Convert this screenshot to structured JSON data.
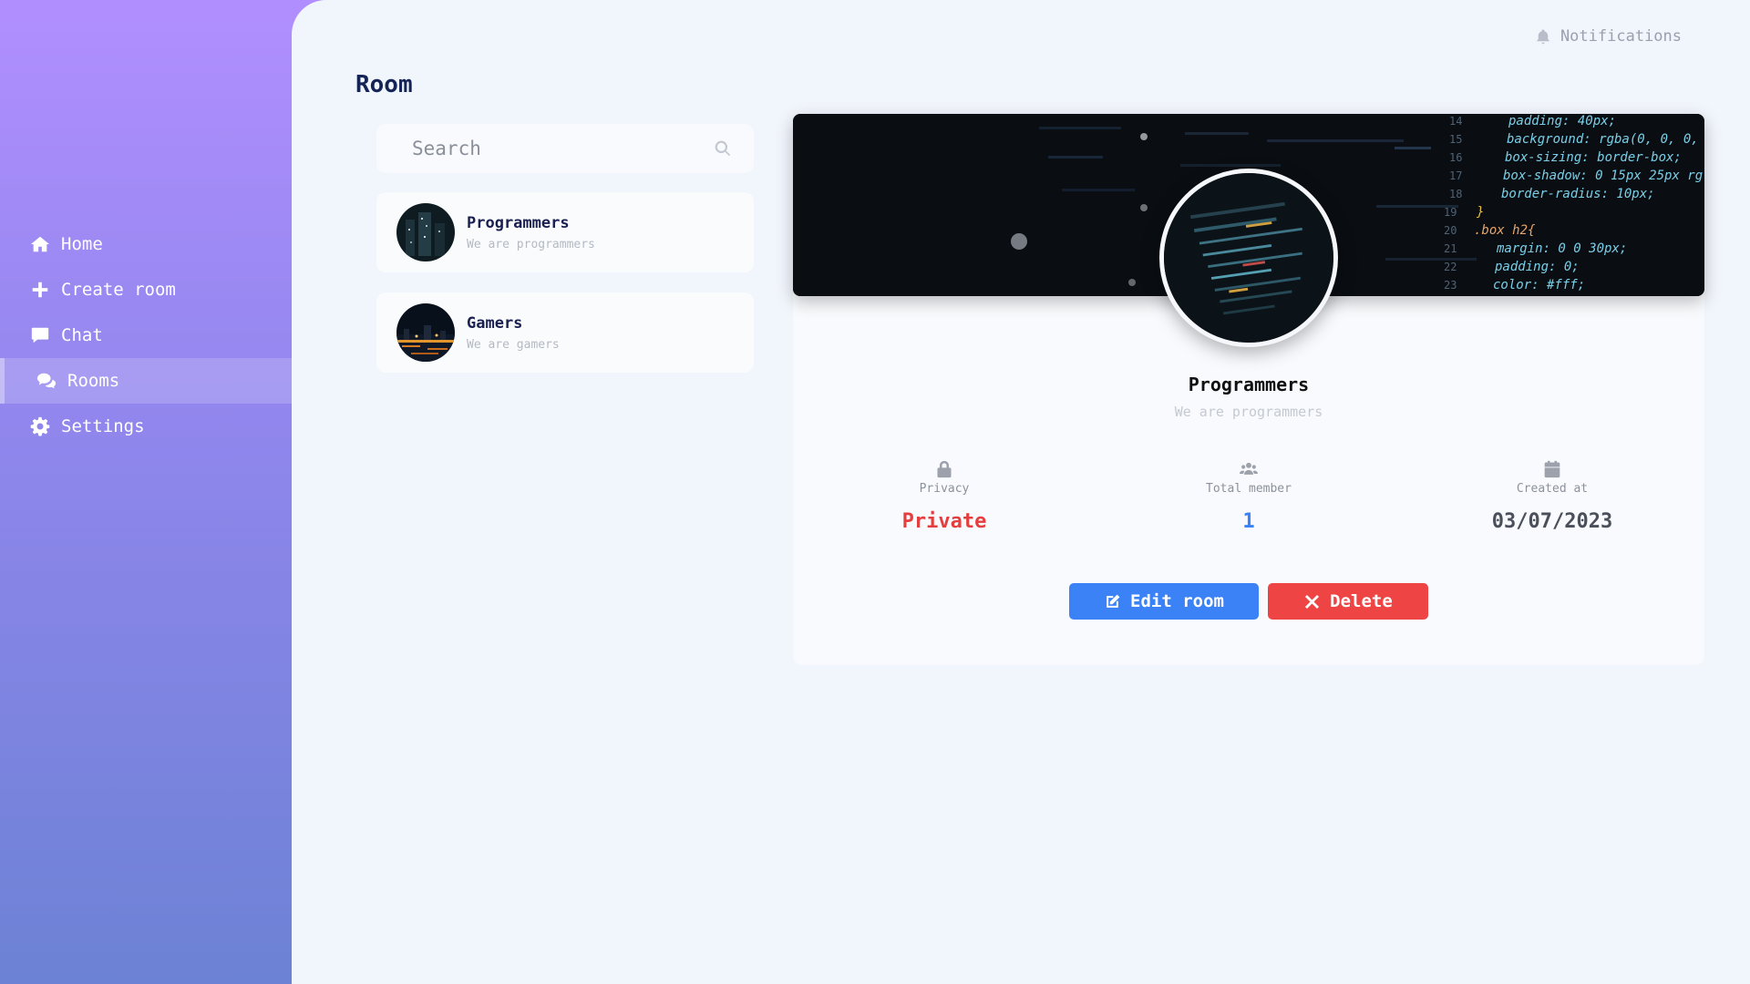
{
  "sidebar": {
    "items": [
      {
        "label": "Home",
        "icon": "home-icon"
      },
      {
        "label": "Create room",
        "icon": "plus-icon"
      },
      {
        "label": "Chat",
        "icon": "chat-icon"
      },
      {
        "label": "Rooms",
        "icon": "comments-icon",
        "active": true
      },
      {
        "label": "Settings",
        "icon": "gear-icon"
      }
    ]
  },
  "header": {
    "notifications_label": "Notifications",
    "page_title": "Room"
  },
  "search": {
    "placeholder": "Search"
  },
  "rooms": [
    {
      "name": "Programmers",
      "description": "We are programmers"
    },
    {
      "name": "Gamers",
      "description": "We are gamers"
    }
  ],
  "selected_room": {
    "name": "Programmers",
    "description": "We are programmers",
    "stats": {
      "privacy": {
        "label": "Privacy",
        "value": "Private"
      },
      "members": {
        "label": "Total member",
        "value": "1"
      },
      "created": {
        "label": "Created at",
        "value": "03/07/2023"
      }
    },
    "banner_code_lines": [
      {
        "num": "14",
        "text": "padding: 40px;"
      },
      {
        "num": "15",
        "text": "background: rgba(0, 0, 0,"
      },
      {
        "num": "16",
        "text": "box-sizing: border-box;"
      },
      {
        "num": "17",
        "text": "box-shadow: 0 15px 25px rg"
      },
      {
        "num": "18",
        "text": "border-radius: 10px;"
      },
      {
        "num": "19",
        "text": "}"
      },
      {
        "num": "20",
        "text": ".box h2{"
      },
      {
        "num": "21",
        "text": "margin: 0 0 30px;"
      },
      {
        "num": "22",
        "text": "padding: 0;"
      },
      {
        "num": "23",
        "text": "color: #fff;"
      }
    ]
  },
  "actions": {
    "edit_label": "Edit room",
    "delete_label": "Delete"
  },
  "colors": {
    "accent_blue": "#3b82f6",
    "danger_red": "#ef4444",
    "private_red": "#e53e3e",
    "member_blue": "#3b82f6",
    "date_gray": "#4a4f59",
    "title_navy": "#142456"
  }
}
